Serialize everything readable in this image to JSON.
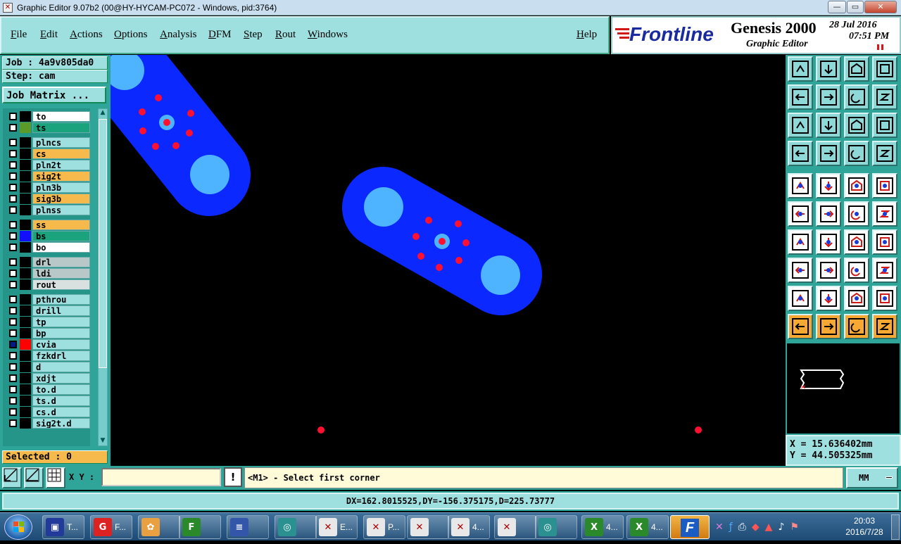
{
  "window": {
    "title": "Graphic Editor 9.07b2 (00@HY-HYCAM-PC072 - Windows, pid:3764)",
    "controls": [
      "—",
      "▭",
      "✕"
    ]
  },
  "menu": {
    "items": [
      "File",
      "Edit",
      "Actions",
      "Options",
      "Analysis",
      "DFM",
      "Step",
      "Rout",
      "Windows"
    ],
    "help": "Help"
  },
  "brand": {
    "logo": "Frontline",
    "product": "Genesis 2000",
    "subtitle": "Graphic Editor",
    "date": "28 Jul 2016",
    "time": "07:51 PM"
  },
  "job": {
    "job_label": "Job : 4a9v805da0",
    "step_label": "Step: cam",
    "matrix_button": "Job Matrix ...",
    "selected_label": "Selected : 0"
  },
  "layers": [
    {
      "name": "to",
      "color": "#ffffff",
      "swatch": "#000000"
    },
    {
      "name": "ts",
      "color": "#1aa37c",
      "swatch": "#5a9a2a"
    },
    {
      "name": "plncs",
      "color": "#9ee0e0",
      "swatch": "#000000"
    },
    {
      "name": "cs",
      "color": "#f6b94b",
      "swatch": "#000000"
    },
    {
      "name": "pln2t",
      "color": "#9ee0e0",
      "swatch": "#000000"
    },
    {
      "name": "sig2t",
      "color": "#f6b94b",
      "swatch": "#000000"
    },
    {
      "name": "pln3b",
      "color": "#9ee0e0",
      "swatch": "#000000"
    },
    {
      "name": "sig3b",
      "color": "#f6b94b",
      "swatch": "#000000"
    },
    {
      "name": "plnss",
      "color": "#9ee0e0",
      "swatch": "#000000"
    },
    {
      "name": "ss",
      "color": "#f6b94b",
      "swatch": "#000000"
    },
    {
      "name": "bs",
      "color": "#1aa37c",
      "swatch": "#1010ff"
    },
    {
      "name": "bo",
      "color": "#ffffff",
      "swatch": "#000000"
    },
    {
      "name": "drl",
      "color": "#b8c8c8",
      "swatch": "#000000"
    },
    {
      "name": "ldi",
      "color": "#b8c8c8",
      "swatch": "#000000"
    },
    {
      "name": "rout",
      "color": "#d8e0e0",
      "swatch": "#000000"
    },
    {
      "name": "pthrou",
      "color": "#9ee0e0",
      "swatch": "#000000"
    },
    {
      "name": "drill",
      "color": "#9ee0e0",
      "swatch": "#000000"
    },
    {
      "name": "tp",
      "color": "#9ee0e0",
      "swatch": "#000000"
    },
    {
      "name": "bp",
      "color": "#9ee0e0",
      "swatch": "#000000"
    },
    {
      "name": "cvia",
      "color": "#9ee0e0",
      "swatch": "#ff0000"
    },
    {
      "name": "fzkdrl",
      "color": "#9ee0e0",
      "swatch": "#000000"
    },
    {
      "name": "d",
      "color": "#9ee0e0",
      "swatch": "#000000"
    },
    {
      "name": "xdjt",
      "color": "#9ee0e0",
      "swatch": "#000000"
    },
    {
      "name": "to.d",
      "color": "#9ee0e0",
      "swatch": "#000000"
    },
    {
      "name": "ts.d",
      "color": "#9ee0e0",
      "swatch": "#000000"
    },
    {
      "name": "cs.d",
      "color": "#9ee0e0",
      "swatch": "#000000"
    },
    {
      "name": "sig2t.d",
      "color": "#9ee0e0",
      "swatch": "#000000"
    }
  ],
  "coords": {
    "x": "X = 15.636402mm",
    "y": "Y = 44.505325mm"
  },
  "command": {
    "xy_label": "X Y :",
    "xy_value": "",
    "prompt": "<M1> - Select first corner",
    "units": "MM",
    "alert": "!"
  },
  "status": {
    "measure": "DX=162.8015525,DY=-156.375175,D=225.73777"
  },
  "taskbar": {
    "items": [
      "T...",
      "F...",
      "",
      "",
      "",
      "",
      "E...",
      "P...",
      "",
      "4...",
      "",
      "",
      "4...",
      "4...",
      ""
    ],
    "clock_time": "20:03",
    "clock_date": "2016/7/28"
  },
  "colors": {
    "pad_blue": "#0a28ff",
    "hole_light": "#4fb4ff",
    "via_red": "#ff1030",
    "panel_teal": "#2fa59a",
    "panel_light": "#9ee0e0"
  }
}
